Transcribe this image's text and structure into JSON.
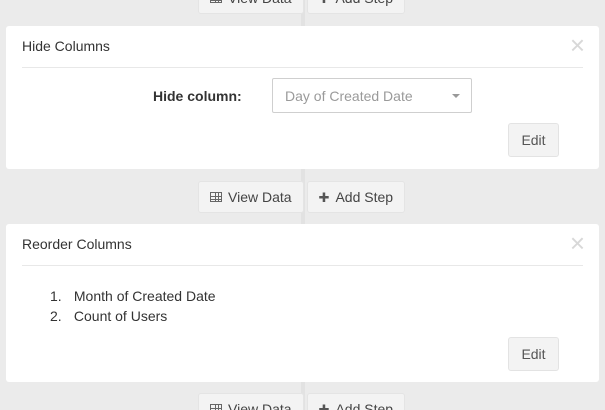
{
  "actions": {
    "view_data": "View Data",
    "add_step": "Add Step"
  },
  "hide_columns": {
    "title": "Hide Columns",
    "field_label": "Hide column:",
    "select_value": "Day of Created Date",
    "edit": "Edit"
  },
  "reorder_columns": {
    "title": "Reorder Columns",
    "items": [
      {
        "num": "1.",
        "label": "Month of Created Date"
      },
      {
        "num": "2.",
        "label": "Count of Users"
      }
    ],
    "edit": "Edit"
  },
  "icons": {
    "view_data": "table-grid-icon",
    "add_step": "plus-icon",
    "close": "close-icon",
    "select": "caret-down-icon"
  }
}
